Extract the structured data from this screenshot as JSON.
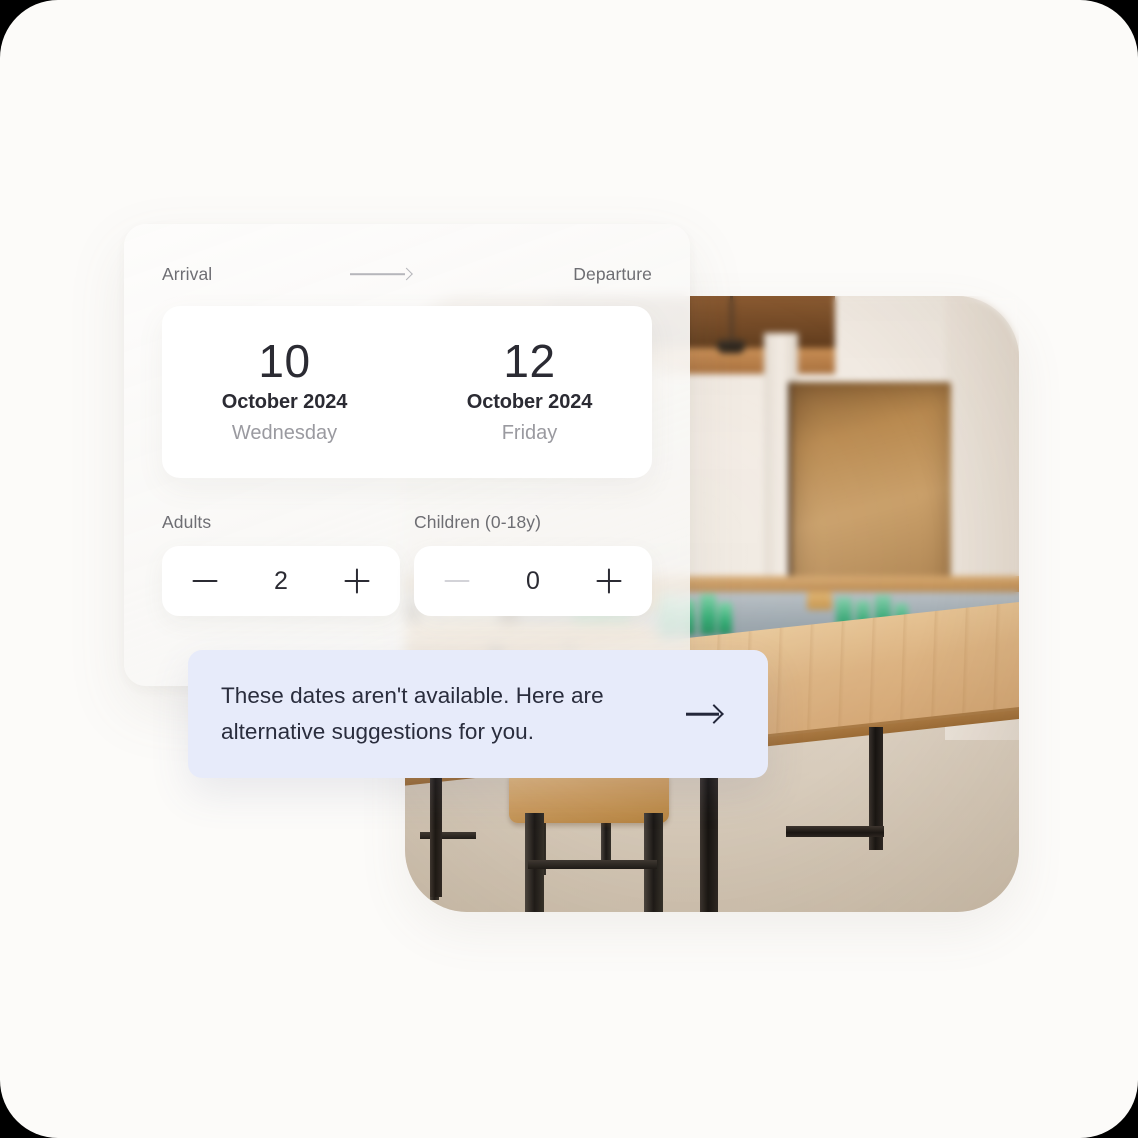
{
  "theme": {
    "page_background": "#fcfbf9",
    "panel_background": "#fdfcfb",
    "card_background": "#ffffff",
    "alert_background": "#e7ebfa",
    "text_primary": "#2b2b33",
    "text_secondary": "#6e6e73",
    "text_muted": "#9a9aa0",
    "alert_text": "#2a2d3d",
    "disabled": "#d3d3d8"
  },
  "booking_panel": {
    "date_header": {
      "arrival_label": "Arrival",
      "departure_label": "Departure",
      "connector_icon": "arrow-right-icon"
    },
    "dates": [
      {
        "role": "arrival",
        "day": "10",
        "month_year": "October 2024",
        "weekday": "Wednesday"
      },
      {
        "role": "departure",
        "day": "12",
        "month_year": "October 2024",
        "weekday": "Friday"
      }
    ],
    "guests": [
      {
        "key": "adults",
        "label": "Adults",
        "value": "2",
        "decrement_icon": "minus-icon",
        "increment_icon": "plus-icon",
        "decrement_disabled": false
      },
      {
        "key": "children",
        "label": "Children (0-18y)",
        "value": "0",
        "decrement_icon": "minus-icon",
        "increment_icon": "plus-icon",
        "decrement_disabled": true
      }
    ]
  },
  "alert": {
    "message": "These dates aren't available. Here are alternative suggestions for you.",
    "action_icon": "arrow-right-icon"
  },
  "photo": {
    "alt": "Restaurant interior with wooden butcher-block table, metal bar stools, pendant lights and exposed ceiling beams"
  }
}
